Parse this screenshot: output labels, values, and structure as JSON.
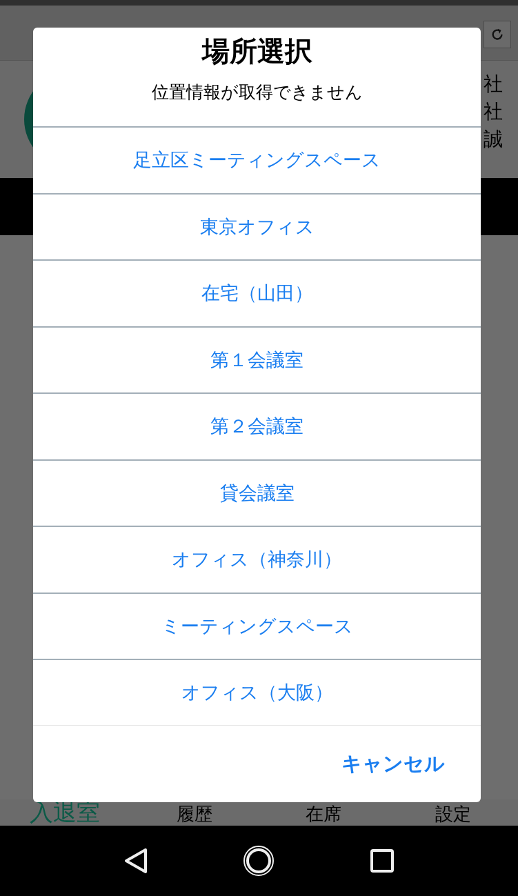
{
  "background": {
    "side_texts": [
      "社",
      "社",
      "誠"
    ]
  },
  "tabs": [
    {
      "label": "入退室",
      "selected": true
    },
    {
      "label": "履歴",
      "selected": false
    },
    {
      "label": "在席",
      "selected": false
    },
    {
      "label": "設定",
      "selected": false
    }
  ],
  "dialog": {
    "title": "場所選択",
    "message": "位置情報が取得できません",
    "options": [
      "足立区ミーティングスペース",
      "東京オフィス",
      "在宅（山田）",
      "第１会議室",
      "第２会議室",
      "貸会議室",
      "オフィス（神奈川）",
      "ミーティングスペース",
      "オフィス（大阪）"
    ],
    "cancel": "キャンセル"
  }
}
